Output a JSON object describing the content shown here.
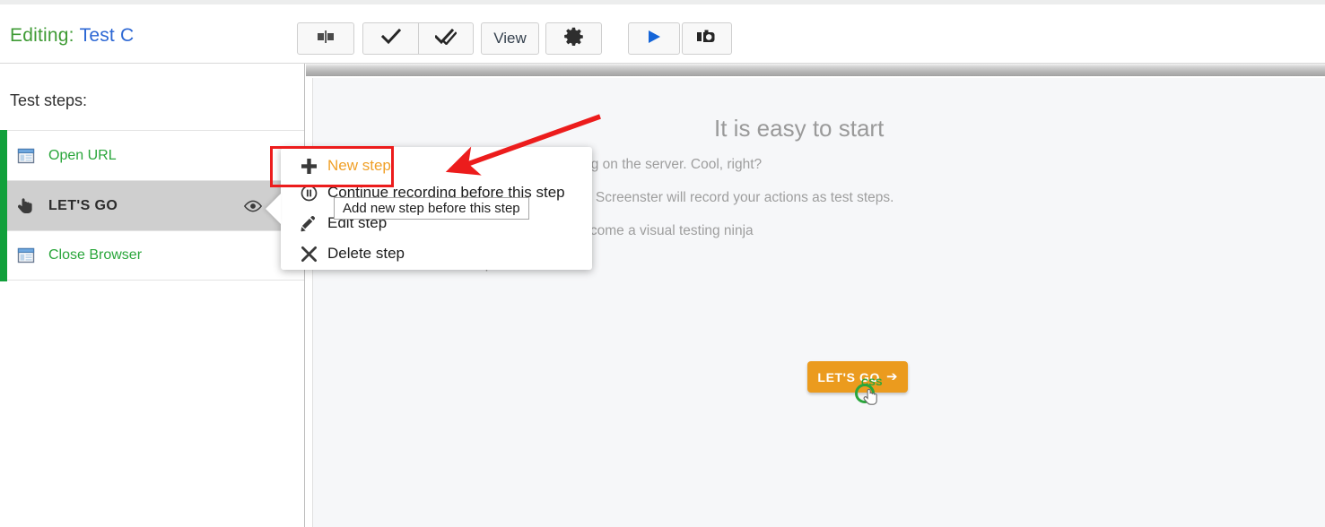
{
  "header": {
    "editing_label": "Editing:",
    "test_name": "Test C",
    "toolbar": {
      "compare_icon": "split-compare-icon",
      "check_icon": "check-icon",
      "double_check_icon": "double-check-icon",
      "view_label": "View",
      "settings_icon": "gear-icon",
      "play_icon": "play-icon",
      "camera_icon": "camera-icon"
    }
  },
  "sidebar": {
    "title": "Test steps:",
    "steps": [
      {
        "label": "Open URL",
        "icon": "browser-window-icon",
        "selected": false,
        "has_eye": false
      },
      {
        "label": "LET'S GO",
        "icon": "hand-pointer-icon",
        "selected": true,
        "has_eye": true
      },
      {
        "label": "Close Browser",
        "icon": "browser-window-icon",
        "selected": false,
        "has_eye": false
      }
    ],
    "accent_bar_color": "#11a03b",
    "step_label_color": "#2aa63b",
    "selected_row_color": "#cfcfcf"
  },
  "context_menu": {
    "items": [
      {
        "label": "New step",
        "icon": "plus-icon",
        "highlighted": true
      },
      {
        "label": "Continue recording before this step",
        "icon": "pause-circle-icon",
        "highlighted": false
      },
      {
        "label": "Edit step",
        "icon": "pencil-icon",
        "highlighted": false
      },
      {
        "label": "Delete step",
        "icon": "close-x-icon",
        "highlighted": false
      }
    ],
    "highlight_color": "#f0a028"
  },
  "tooltip": {
    "text": "Add new step before this step"
  },
  "annotation": {
    "arrow_color": "#ec1c1c",
    "box_color": "#ec1c1c"
  },
  "main": {
    "hero_title": "It is easy to start",
    "paragraphs": [
      "into a browser running on the server. Cool, right?",
      "uttons and enter text. Screenster will record your actions as test steps.",
      "but it will help you become a visual testing ninja",
      "ore productive!"
    ],
    "cta": {
      "label": "LET'S GO",
      "arrow": "➔",
      "bg_color": "#eb9b1e",
      "text_color": "#ffffff"
    },
    "selector_badge": {
      "label": "CSS",
      "color": "#2aa63b"
    }
  }
}
